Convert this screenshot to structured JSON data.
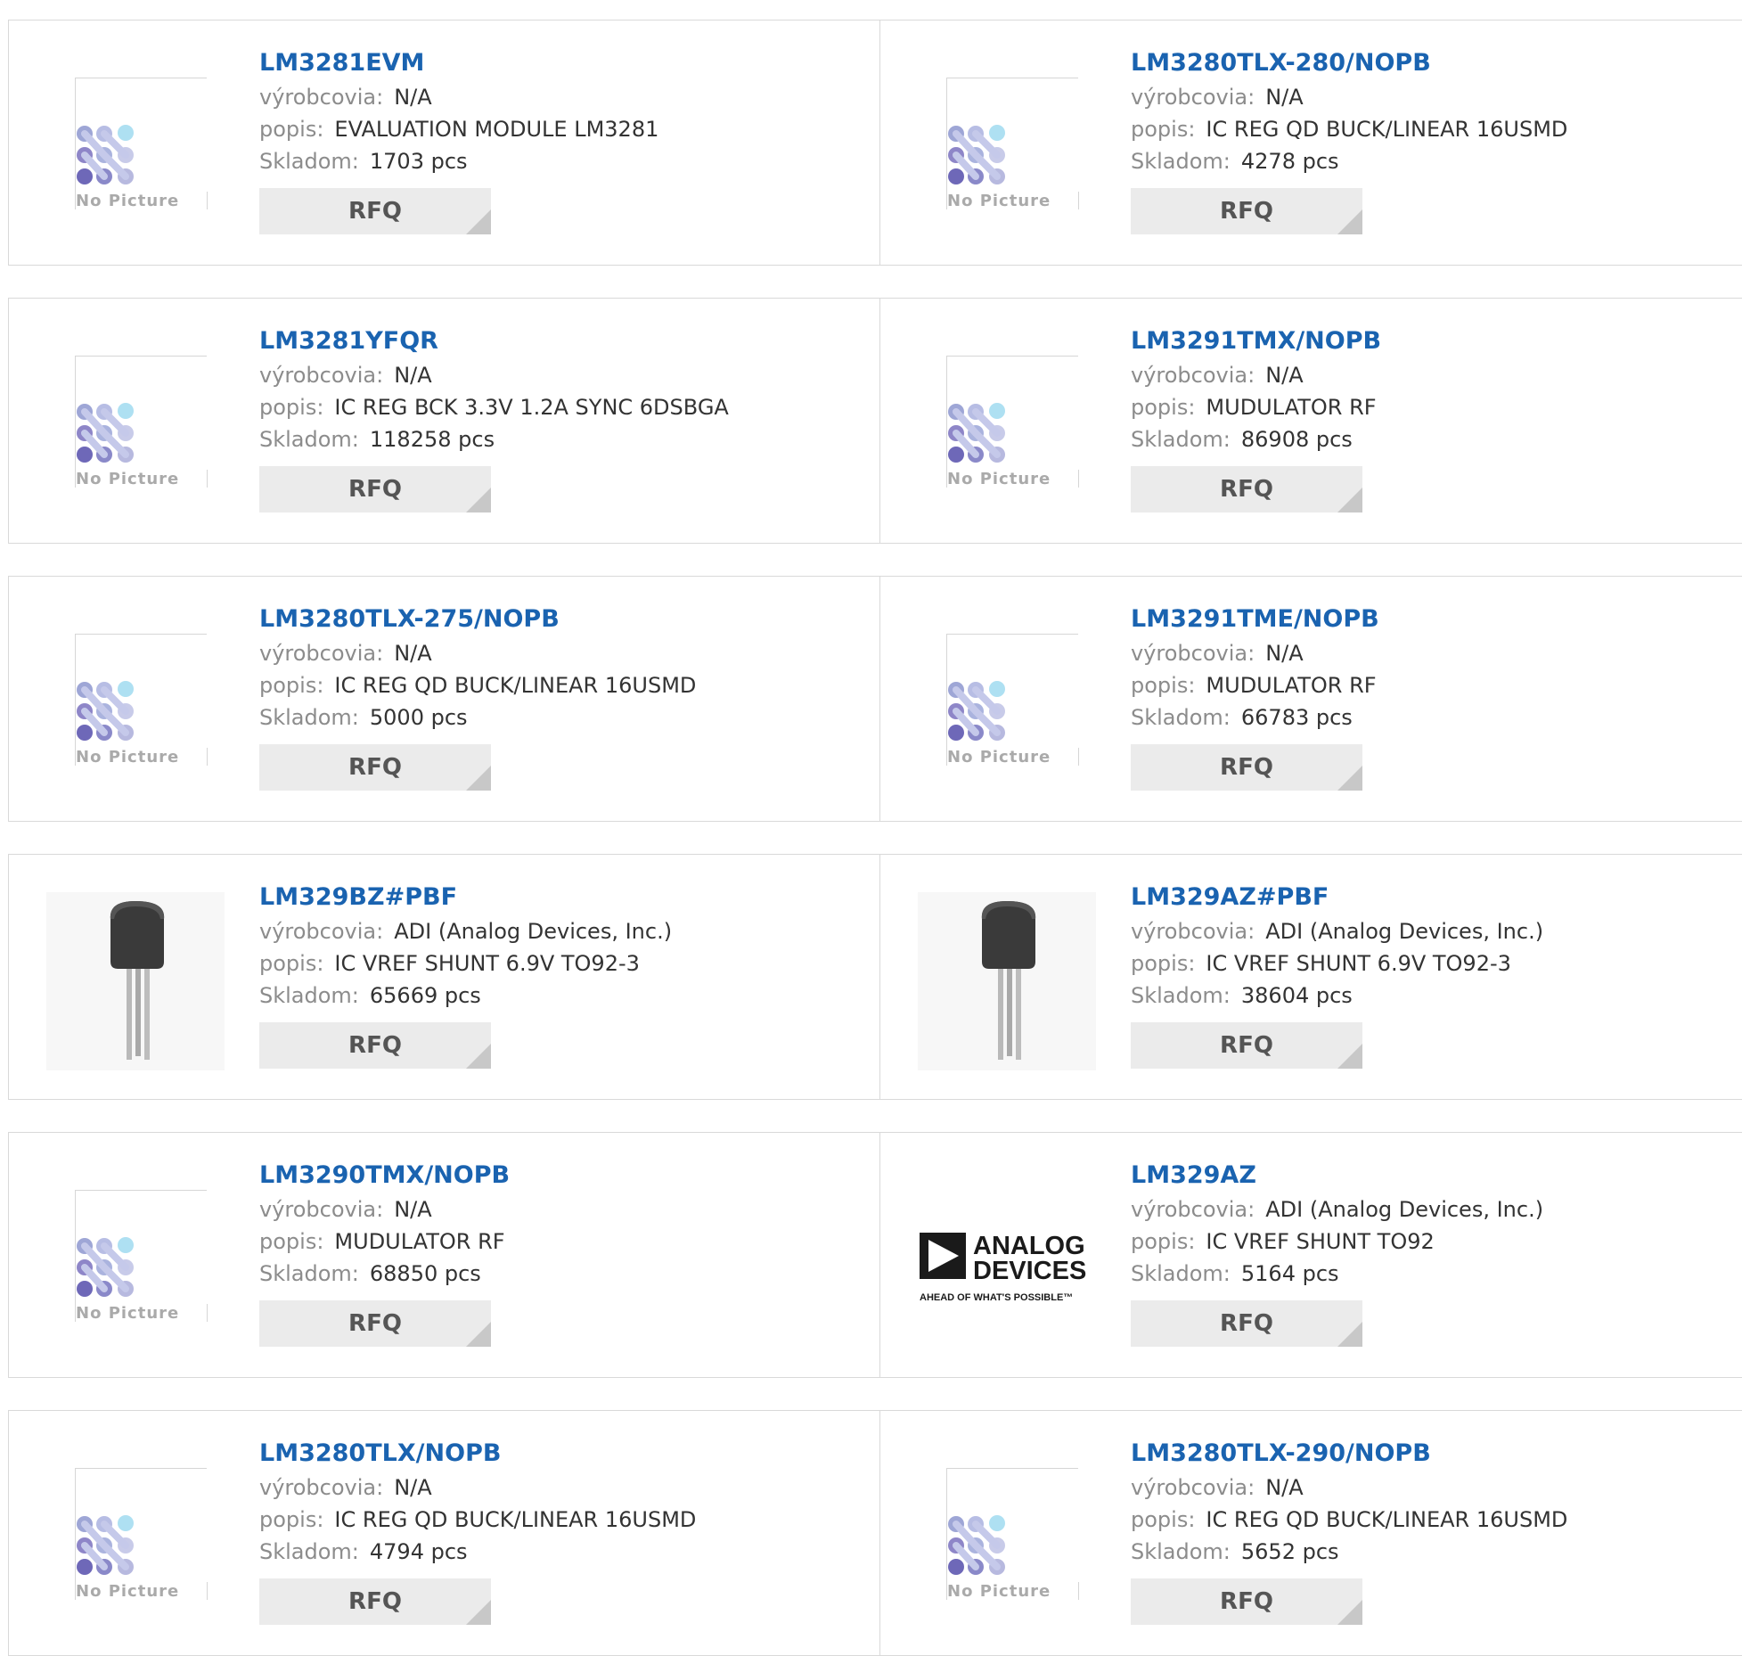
{
  "labels": {
    "manufacturer": "výrobcovia:",
    "description": "popis:",
    "stock": "Skladom:",
    "rfq": "RFQ",
    "no_picture": "No Picture"
  },
  "adi_logo": {
    "line1": "ANALOG",
    "line2": "DEVICES",
    "tagline": "AHEAD OF WHAT'S POSSIBLE™"
  },
  "products": [
    {
      "part": "LM3281EVM",
      "manufacturer": "N/A",
      "description": "EVALUATION MODULE LM3281",
      "stock": "1703 pcs",
      "image": "no-picture"
    },
    {
      "part": "LM3280TLX-280/NOPB",
      "manufacturer": "N/A",
      "description": "IC REG QD BUCK/LINEAR 16USMD",
      "stock": "4278 pcs",
      "image": "no-picture"
    },
    {
      "part": "LM3281YFQR",
      "manufacturer": "N/A",
      "description": "IC REG BCK 3.3V 1.2A SYNC 6DSBGA",
      "stock": "118258 pcs",
      "image": "no-picture"
    },
    {
      "part": "LM3291TMX/NOPB",
      "manufacturer": "N/A",
      "description": "MUDULATOR RF",
      "stock": "86908 pcs",
      "image": "no-picture"
    },
    {
      "part": "LM3280TLX-275/NOPB",
      "manufacturer": "N/A",
      "description": "IC REG QD BUCK/LINEAR 16USMD",
      "stock": "5000 pcs",
      "image": "no-picture"
    },
    {
      "part": "LM3291TME/NOPB",
      "manufacturer": "N/A",
      "description": "MUDULATOR RF",
      "stock": "66783 pcs",
      "image": "no-picture"
    },
    {
      "part": "LM329BZ#PBF",
      "manufacturer": "ADI (Analog Devices, Inc.)",
      "description": "IC VREF SHUNT 6.9V TO92-3",
      "stock": "65669 pcs",
      "image": "transistor"
    },
    {
      "part": "LM329AZ#PBF",
      "manufacturer": "ADI (Analog Devices, Inc.)",
      "description": "IC VREF SHUNT 6.9V TO92-3",
      "stock": "38604 pcs",
      "image": "transistor"
    },
    {
      "part": "LM3290TMX/NOPB",
      "manufacturer": "N/A",
      "description": "MUDULATOR RF",
      "stock": "68850 pcs",
      "image": "no-picture"
    },
    {
      "part": "LM329AZ",
      "manufacturer": "ADI (Analog Devices, Inc.)",
      "description": "IC VREF SHUNT TO92",
      "stock": "5164 pcs",
      "image": "adi-logo"
    },
    {
      "part": "LM3280TLX/NOPB",
      "manufacturer": "N/A",
      "description": "IC REG QD BUCK/LINEAR 16USMD",
      "stock": "4794 pcs",
      "image": "no-picture"
    },
    {
      "part": "LM3280TLX-290/NOPB",
      "manufacturer": "N/A",
      "description": "IC REG QD BUCK/LINEAR 16USMD",
      "stock": "5652 pcs",
      "image": "no-picture"
    }
  ]
}
